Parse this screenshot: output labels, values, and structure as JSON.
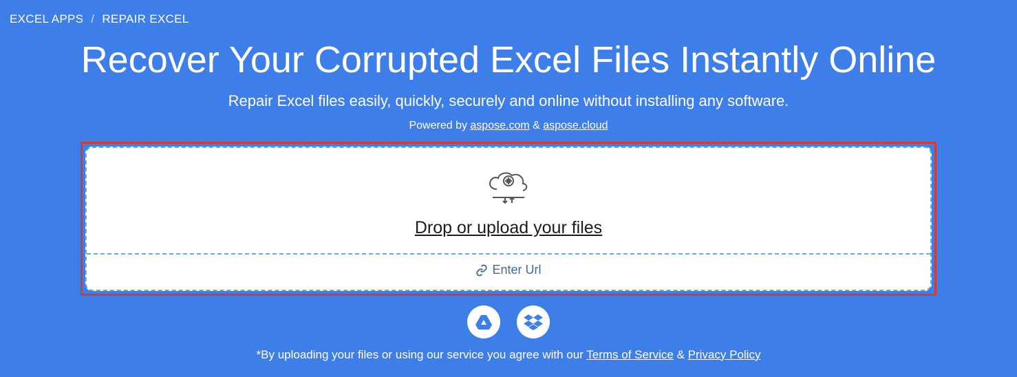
{
  "breadcrumb": {
    "root": "EXCEL APPS",
    "sep": "/",
    "current": "REPAIR EXCEL"
  },
  "hero": {
    "title": "Recover Your Corrupted Excel Files Instantly Online",
    "sub": "Repair Excel files easily, quickly, securely and online without installing any software."
  },
  "powered": {
    "prefix": "Powered by ",
    "link1": "aspose.com",
    "amp": " & ",
    "link2": "aspose.cloud"
  },
  "upload": {
    "drop_label": "Drop or upload your files",
    "enter_url_label": "Enter Url"
  },
  "footer": {
    "prefix": "*By uploading your files or using our service you agree with our ",
    "tos": "Terms of Service",
    "amp": " & ",
    "privacy": "Privacy Policy"
  }
}
